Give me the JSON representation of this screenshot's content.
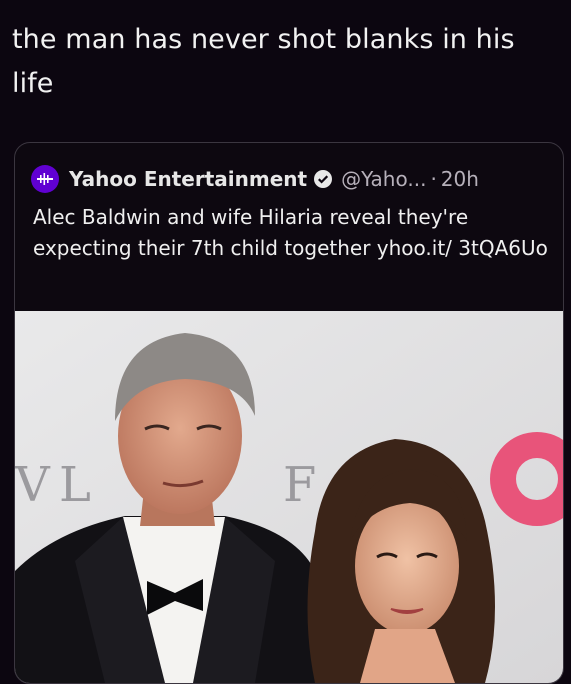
{
  "post": {
    "caption": "the man has never shot blanks in his life"
  },
  "tweet": {
    "author": "Yahoo Entertainment",
    "handle": "@Yaho...",
    "separator": "·",
    "time": "20h",
    "text": "Alec Baldwin and wife Hilaria reveal they're expecting their 7th child together yhoo.it/ 3tQA6Uo"
  },
  "colors": {
    "yahoo_purple": "#6001d2",
    "background": "#0c0610",
    "card_border": "#3b3640"
  },
  "icons": [
    "yahoo-logo-icon",
    "verified-badge-icon"
  ]
}
